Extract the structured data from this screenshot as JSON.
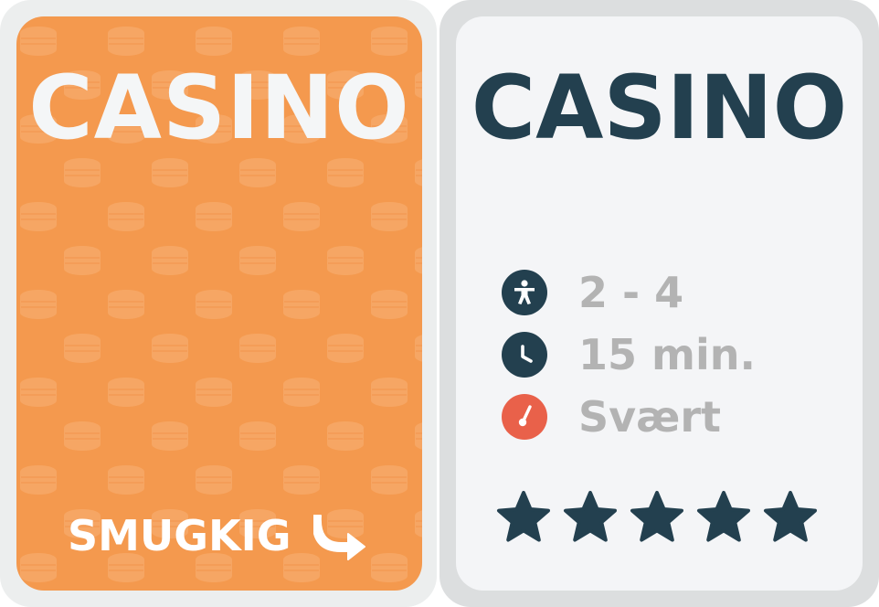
{
  "front_card": {
    "title": "CASINO",
    "peek_label": "SMUGKIG",
    "peek_icon": "arrow-turn-right-icon",
    "background_color": "#f4994e",
    "pattern": "coin-stacks"
  },
  "back_card": {
    "title": "CASINO",
    "players": {
      "icon": "person-icon",
      "value": "2 - 4"
    },
    "duration": {
      "icon": "clock-icon",
      "value": "15 min."
    },
    "difficulty": {
      "icon": "gauge-icon",
      "value": "Svært",
      "color": "#e9614a"
    },
    "rating": {
      "value": 5,
      "max": 5,
      "star_color": "#23404f"
    }
  }
}
